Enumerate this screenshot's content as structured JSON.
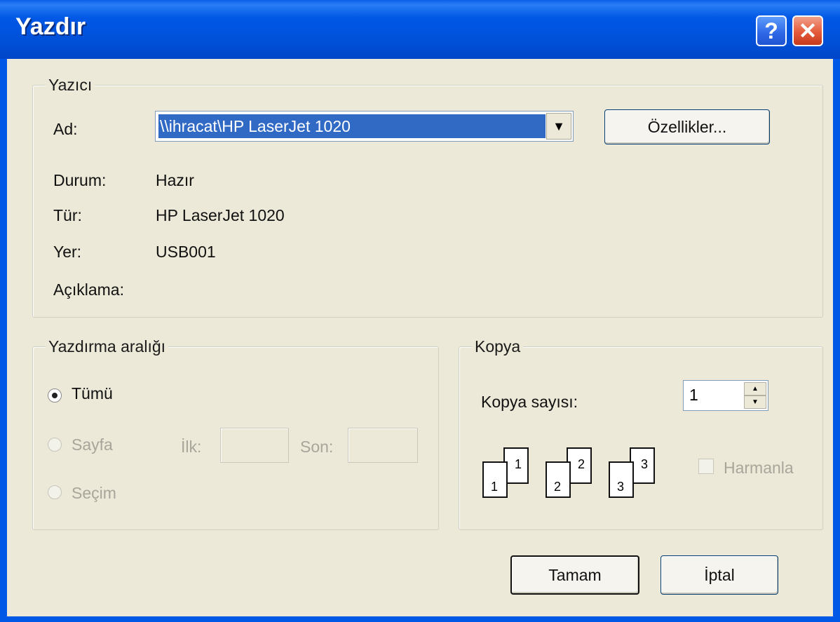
{
  "window": {
    "title": "Yazdır",
    "help_glyph": "?",
    "close_glyph": "✕"
  },
  "printer": {
    "group_label": "Yazıcı",
    "name_label": "Ad:",
    "name_value": "\\\\ihracat\\HP LaserJet 1020",
    "properties_button": "Özellikler...",
    "status_label": "Durum:",
    "status_value": "Hazır",
    "type_label": "Tür:",
    "type_value": "HP LaserJet 1020",
    "location_label": "Yer:",
    "location_value": "USB001",
    "comment_label": "Açıklama:",
    "comment_value": ""
  },
  "print_range": {
    "group_label": "Yazdırma aralığı",
    "all_label": "Tümü",
    "all_selected": true,
    "pages_label": "Sayfa",
    "from_label": "İlk:",
    "from_value": "",
    "to_label": "Son:",
    "to_value": "",
    "selection_label": "Seçim"
  },
  "copies": {
    "group_label": "Kopya",
    "count_label": "Kopya sayısı:",
    "count_value": "1",
    "collate_label": "Harmanla",
    "collate_checked": false,
    "page_numbers": [
      "1",
      "1",
      "2",
      "2",
      "3",
      "3"
    ]
  },
  "buttons": {
    "ok": "Tamam",
    "cancel": "İptal"
  },
  "icons": {
    "dropdown_arrow": "▼",
    "spin_up": "▲",
    "spin_down": "▼"
  },
  "colors": {
    "titlebar": "#0058e6",
    "client": "#ece9d8",
    "selection": "#316ac5"
  }
}
